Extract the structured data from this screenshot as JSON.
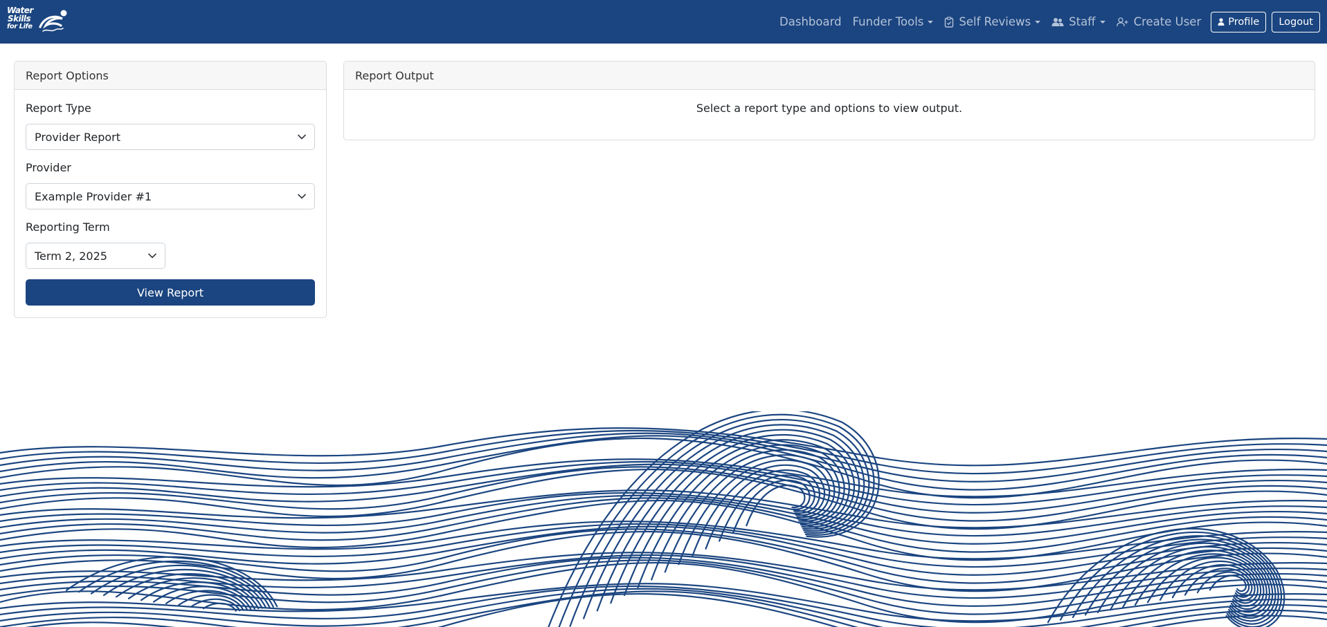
{
  "brand": {
    "lines": [
      "Water",
      "Skills",
      "for Life"
    ],
    "icon": "swimmer-logo"
  },
  "nav": {
    "dashboard": "Dashboard",
    "funder_tools": "Funder Tools",
    "self_reviews": "Self Reviews",
    "staff": "Staff",
    "create_user": "Create User",
    "profile": "Profile",
    "logout": "Logout"
  },
  "options_card": {
    "title": "Report Options",
    "report_type": {
      "label": "Report Type",
      "value": "Provider Report"
    },
    "provider": {
      "label": "Provider",
      "value": "Example Provider #1"
    },
    "term": {
      "label": "Reporting Term",
      "value": "Term 2, 2025"
    },
    "submit": "View Report"
  },
  "output_card": {
    "title": "Report Output",
    "message": "Select a report type and options to view output."
  },
  "colors": {
    "brand": "#1b4580",
    "nav_text": "#b4c2d8",
    "wave": "#1b4580"
  },
  "decoration": {
    "footer_art": "ocean-waves-illustration"
  }
}
